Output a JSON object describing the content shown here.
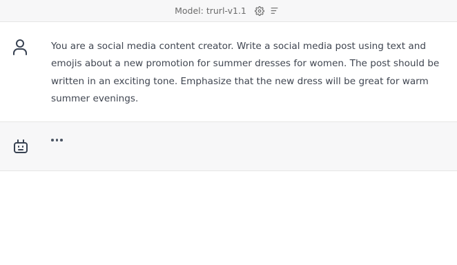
{
  "header": {
    "model_label": "Model: trurl-v1.1",
    "settings_icon": "gear-icon",
    "menu_icon": "lines-menu-icon"
  },
  "messages": [
    {
      "role": "user",
      "avatar_icon": "user-icon",
      "text": "You are a social media content creator. Write a social media post using text and emojis about a new promotion for summer dresses for women. The post should be written in an exciting tone. Emphasize that the new dress will be great for warm summer evenings."
    },
    {
      "role": "assistant",
      "avatar_icon": "robot-icon",
      "loading_icon": "typing-dots-icon"
    }
  ]
}
